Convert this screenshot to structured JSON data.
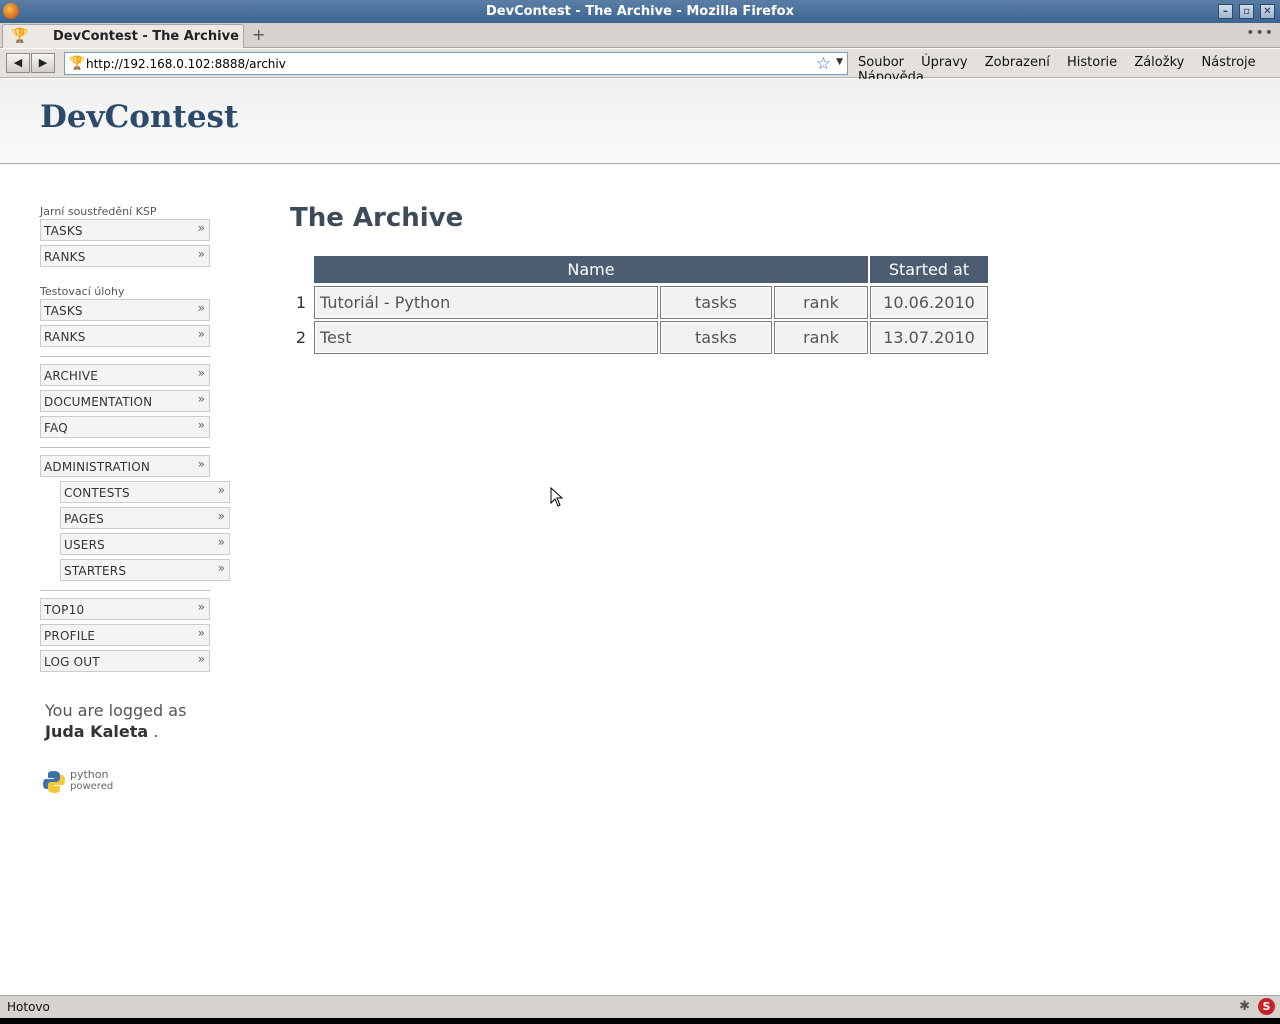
{
  "window": {
    "title": "DevContest - The Archive - Mozilla Firefox",
    "controls": [
      "–",
      "▫",
      "✕"
    ]
  },
  "tabs": [
    {
      "title": "DevContest - The Archive",
      "icon": "trophy-icon"
    }
  ],
  "newtab_label": "+",
  "tabmenu_label": "•••",
  "nav": {
    "back": "◀",
    "forward": "▶",
    "url": "http://192.168.0.102:8888/archiv",
    "star": "☆",
    "drop": "▼"
  },
  "menu": [
    "Soubor",
    "Úpravy",
    "Zobrazení",
    "Historie",
    "Záložky",
    "Nástroje",
    "Nápověda"
  ],
  "site": {
    "title": "DevContest"
  },
  "sidebar": {
    "contest1": {
      "label": "Jarní soustředění KSP",
      "items": [
        "TASKS",
        "RANKS"
      ]
    },
    "contest2": {
      "label": "Testovací úlohy",
      "items": [
        "TASKS",
        "RANKS"
      ]
    },
    "general": [
      "ARCHIVE",
      "DOCUMENTATION",
      "FAQ"
    ],
    "admin": {
      "label": "ADMINISTRATION",
      "items": [
        "CONTESTS",
        "PAGES",
        "USERS",
        "STARTERS"
      ]
    },
    "user": [
      "TOP10",
      "PROFILE",
      "LOG OUT"
    ],
    "arrow": "»",
    "logged_prefix": "You are logged as",
    "logged_user": "Juda Kaleta",
    "logged_suffix": ".",
    "python_badge": [
      "python",
      "powered"
    ]
  },
  "main": {
    "title": "The Archive",
    "headers": [
      "Name",
      "Started at"
    ],
    "rows": [
      {
        "num": "1",
        "name": "Tutoriál - Python",
        "tasks": "tasks",
        "rank": "rank",
        "started": "10.06.2010"
      },
      {
        "num": "2",
        "name": "Test",
        "tasks": "tasks",
        "rank": "rank",
        "started": "13.07.2010"
      }
    ]
  },
  "status": {
    "text": "Hotovo",
    "addon_icon": "S"
  }
}
